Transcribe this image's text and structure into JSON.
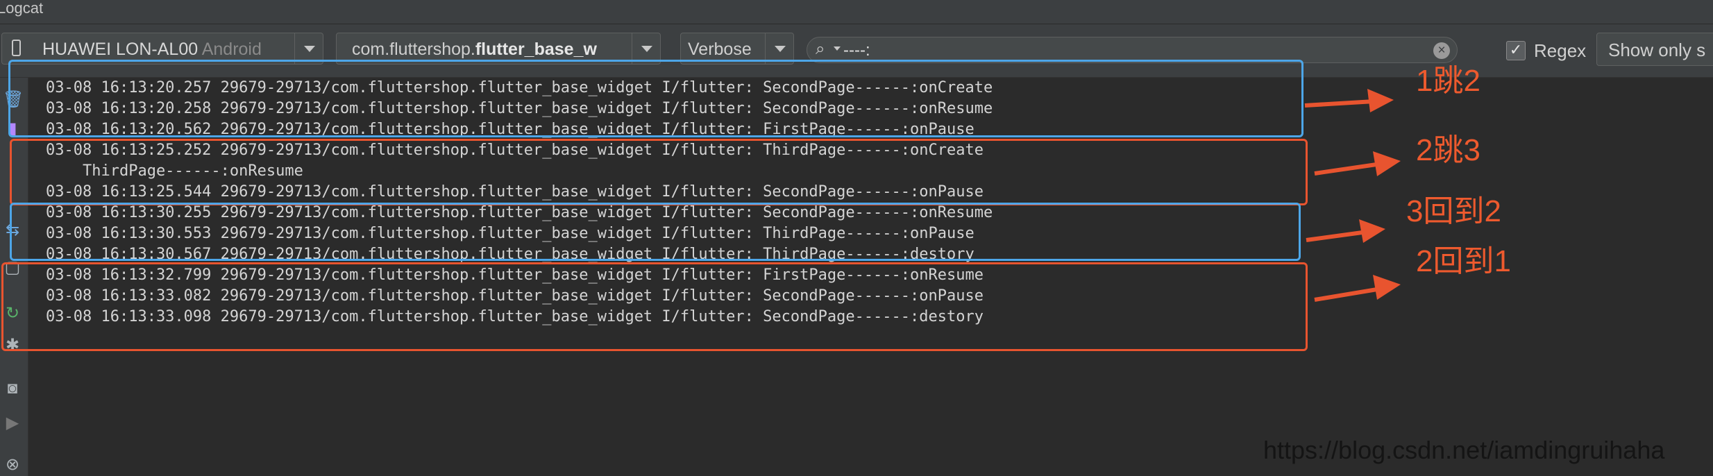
{
  "window": {
    "title": "Logcat"
  },
  "toolbar": {
    "device_name": "HUAWEI LON-AL00",
    "device_os": "Android",
    "package_prefix": "com.fluttershop.",
    "package_bold": "flutter_base_w",
    "log_level": "Verbose",
    "search_query": "----:",
    "regex_label": "Regex",
    "regex_checked": "✓",
    "show_only": "Show only s"
  },
  "log_lines": [
    "03-08 16:13:20.257 29679-29713/com.fluttershop.flutter_base_widget I/flutter: SecondPage------:onCreate",
    "03-08 16:13:20.258 29679-29713/com.fluttershop.flutter_base_widget I/flutter: SecondPage------:onResume",
    "03-08 16:13:20.562 29679-29713/com.fluttershop.flutter_base_widget I/flutter: FirstPage------:onPause",
    "03-08 16:13:25.252 29679-29713/com.fluttershop.flutter_base_widget I/flutter: ThirdPage------:onCreate",
    "    ThirdPage------:onResume",
    "03-08 16:13:25.544 29679-29713/com.fluttershop.flutter_base_widget I/flutter: SecondPage------:onPause",
    "03-08 16:13:30.255 29679-29713/com.fluttershop.flutter_base_widget I/flutter: SecondPage------:onResume",
    "03-08 16:13:30.553 29679-29713/com.fluttershop.flutter_base_widget I/flutter: ThirdPage------:onPause",
    "03-08 16:13:30.567 29679-29713/com.fluttershop.flutter_base_widget I/flutter: ThirdPage------:destory",
    "03-08 16:13:32.799 29679-29713/com.fluttershop.flutter_base_widget I/flutter: FirstPage------:onResume",
    "03-08 16:13:33.082 29679-29713/com.fluttershop.flutter_base_widget I/flutter: SecondPage------:onPause",
    "03-08 16:13:33.098 29679-29713/com.fluttershop.flutter_base_widget I/flutter: SecondPage------:destory"
  ],
  "annotations": [
    "1跳2",
    "2跳3",
    "3回到2",
    "2回到1"
  ],
  "watermark": "https://blog.csdn.net/iamdingruihaha",
  "colors": {
    "annotation_red": "#e8542f",
    "annotation_blue": "#4da6e8",
    "background": "#2b2b2b",
    "toolbar": "#3c3f41"
  },
  "sidebar_icons": [
    "trash-icon",
    "pin-icon",
    "soft-wrap-icon",
    "restart-icon",
    "settings-icon",
    "camera-icon",
    "record-icon",
    "close-icon"
  ]
}
